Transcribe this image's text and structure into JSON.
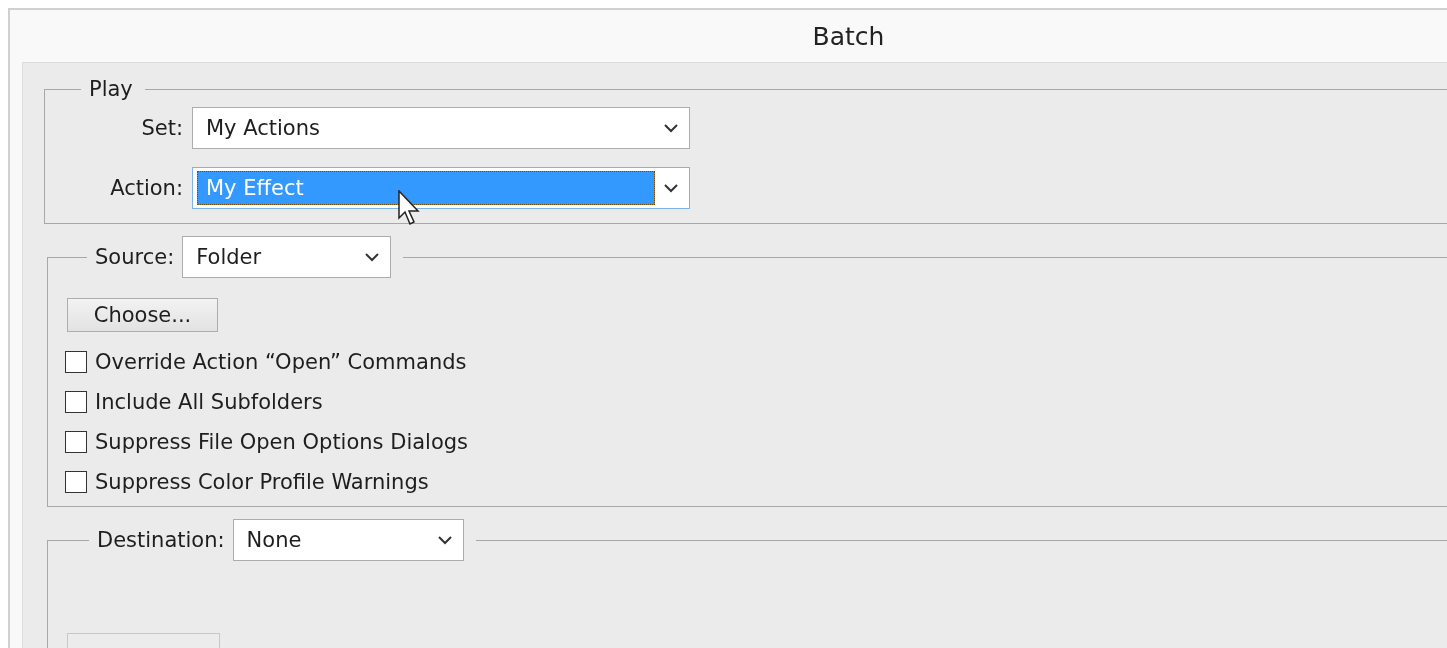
{
  "window": {
    "title": "Batch"
  },
  "play": {
    "legend": "Play",
    "fields": [
      {
        "label": "Set:",
        "value": "My Actions",
        "focused": false
      },
      {
        "label": "Action:",
        "value": "My Effect",
        "focused": true
      }
    ]
  },
  "source": {
    "label": "Source:",
    "value": "Folder",
    "button": "Choose...",
    "options": [
      {
        "label": "Override Action “Open” Commands",
        "checked": false
      },
      {
        "label": "Include All Subfolders",
        "checked": false
      },
      {
        "label": "Suppress File Open Options Dialogs",
        "checked": false
      },
      {
        "label": "Suppress Color Profile Warnings",
        "checked": false
      }
    ]
  },
  "destination": {
    "label": "Destination:",
    "value": "None"
  }
}
